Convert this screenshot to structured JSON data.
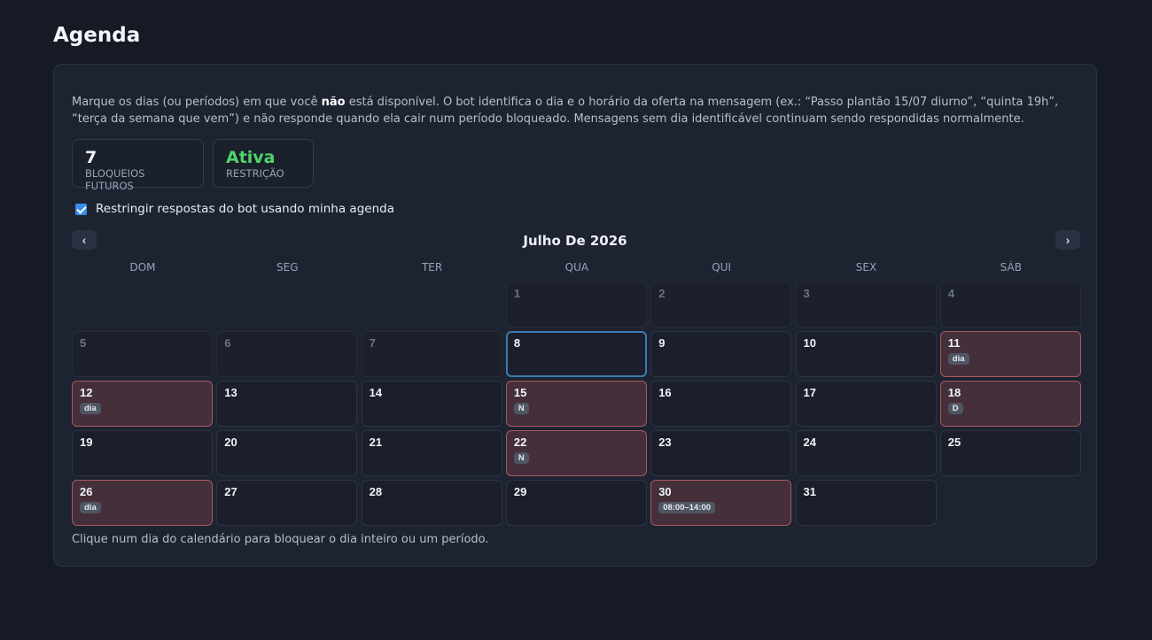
{
  "page": {
    "title": "Agenda"
  },
  "description": {
    "part1": "Marque os dias (ou períodos) em que você ",
    "bold": "não",
    "part2": " está disponível. O bot identifica o dia e o horário da oferta na mensagem (ex.: “Passo plantão 15/07 diurno”, “quinta 19h”, “terça da semana que vem”) e não responde quando ela cair num período bloqueado. Mensagens sem dia identificável continuam sendo respondidas normalmente."
  },
  "stats": [
    {
      "value": "7",
      "label": "BLOQUEIOS FUTUROS"
    },
    {
      "value": "Ativa",
      "label": "RESTRIÇÃO"
    }
  ],
  "restrict_checkbox": {
    "label": "Restringir respostas do bot usando minha agenda",
    "checked": true
  },
  "calendar": {
    "month_label": "Julho De 2026",
    "prev_label": "‹",
    "next_label": "›",
    "weekdays": [
      "DOM",
      "SEG",
      "TER",
      "QUA",
      "QUI",
      "SEX",
      "SÁB"
    ],
    "first_weekday_index": 3,
    "days": [
      {
        "n": "1",
        "past": true
      },
      {
        "n": "2",
        "past": true
      },
      {
        "n": "3",
        "past": true
      },
      {
        "n": "4",
        "past": true
      },
      {
        "n": "5",
        "past": true
      },
      {
        "n": "6",
        "past": true
      },
      {
        "n": "7",
        "past": true
      },
      {
        "n": "8",
        "today": true
      },
      {
        "n": "9"
      },
      {
        "n": "10"
      },
      {
        "n": "11",
        "tag": "dia"
      },
      {
        "n": "12",
        "tag": "dia"
      },
      {
        "n": "13"
      },
      {
        "n": "14"
      },
      {
        "n": "15",
        "tag": "N"
      },
      {
        "n": "16"
      },
      {
        "n": "17"
      },
      {
        "n": "18",
        "tag": "D"
      },
      {
        "n": "19"
      },
      {
        "n": "20"
      },
      {
        "n": "21"
      },
      {
        "n": "22",
        "tag": "N"
      },
      {
        "n": "23"
      },
      {
        "n": "24"
      },
      {
        "n": "25"
      },
      {
        "n": "26",
        "tag": "dia"
      },
      {
        "n": "27"
      },
      {
        "n": "28"
      },
      {
        "n": "29"
      },
      {
        "n": "30",
        "tag": "08:00–14:00"
      },
      {
        "n": "31"
      }
    ]
  },
  "footnote": "Clique num dia do calendário para bloquear o dia inteiro ou um período.",
  "colors": {
    "accent": "#3b8ee8",
    "active": "#4fd46d",
    "blocked_bg": "#452f3b",
    "blocked_border": "#a85a62"
  }
}
